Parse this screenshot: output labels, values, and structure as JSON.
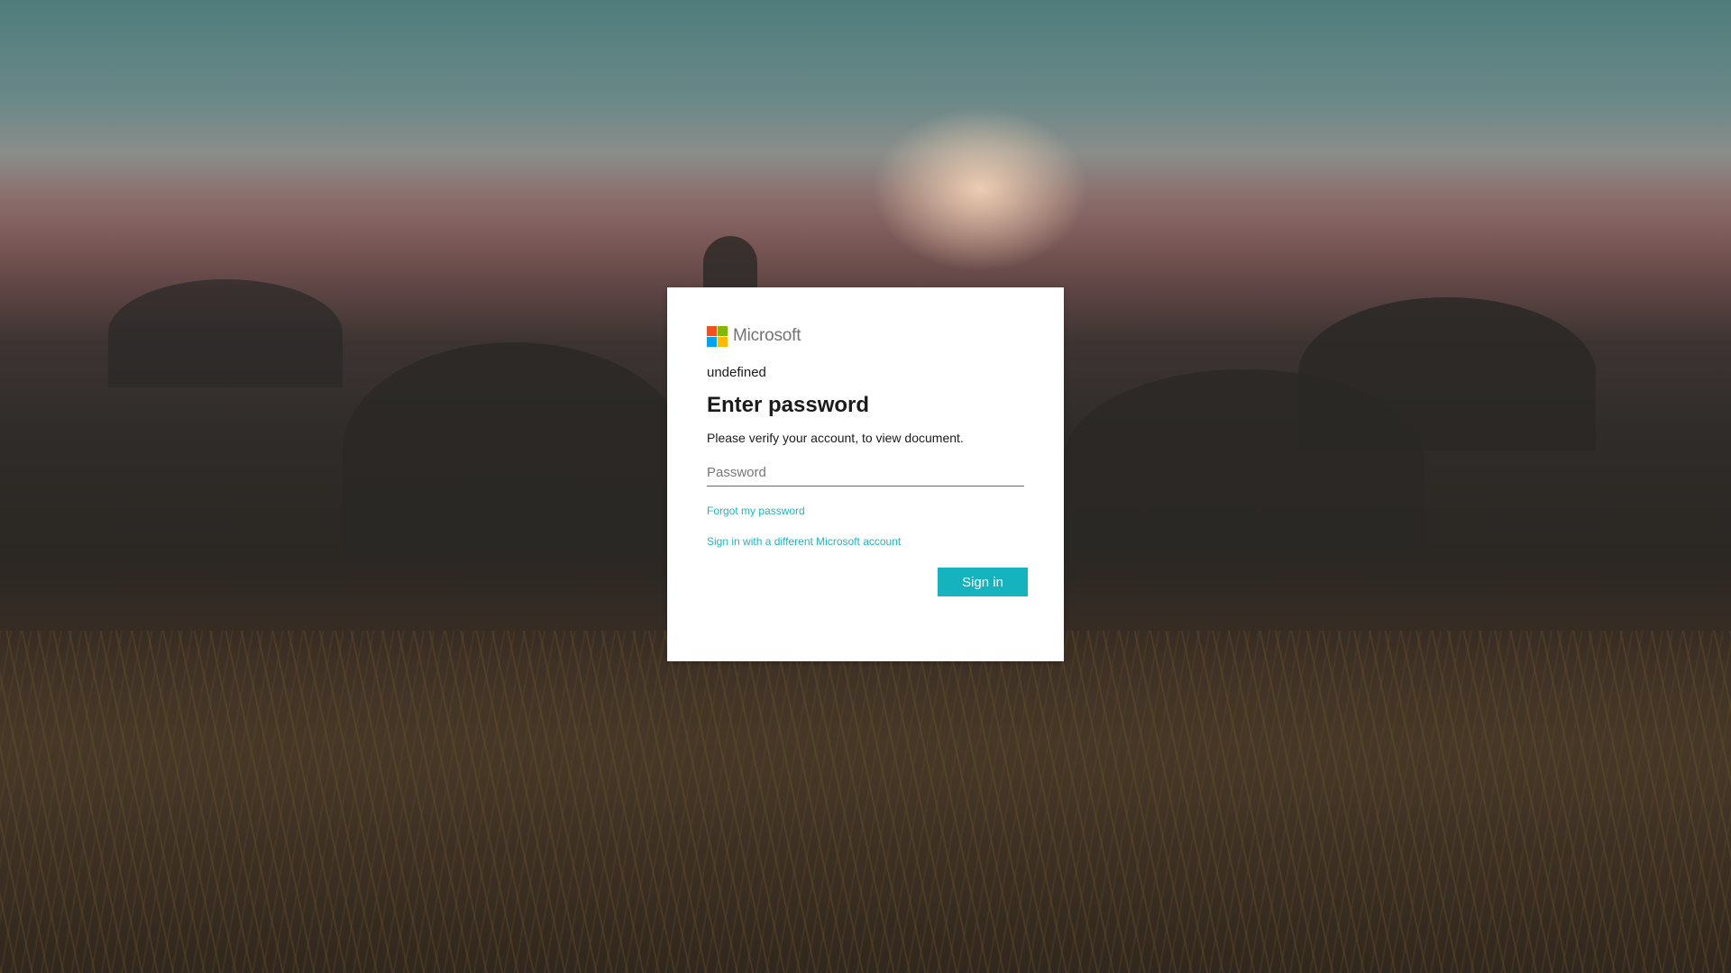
{
  "brand": {
    "name": "Microsoft",
    "logo_colors": [
      "#f25022",
      "#7fba00",
      "#00a4ef",
      "#ffb900"
    ]
  },
  "signin": {
    "identity": "undefined",
    "title": "Enter password",
    "description": "Please verify your account, to view document.",
    "password_placeholder": "Password",
    "password_value": "",
    "forgot_link": "Forgot my password",
    "different_account_link": "Sign in with a different Microsoft account",
    "signin_button": "Sign in"
  },
  "colors": {
    "accent": "#15b3bd",
    "link": "#1ab8c2"
  }
}
